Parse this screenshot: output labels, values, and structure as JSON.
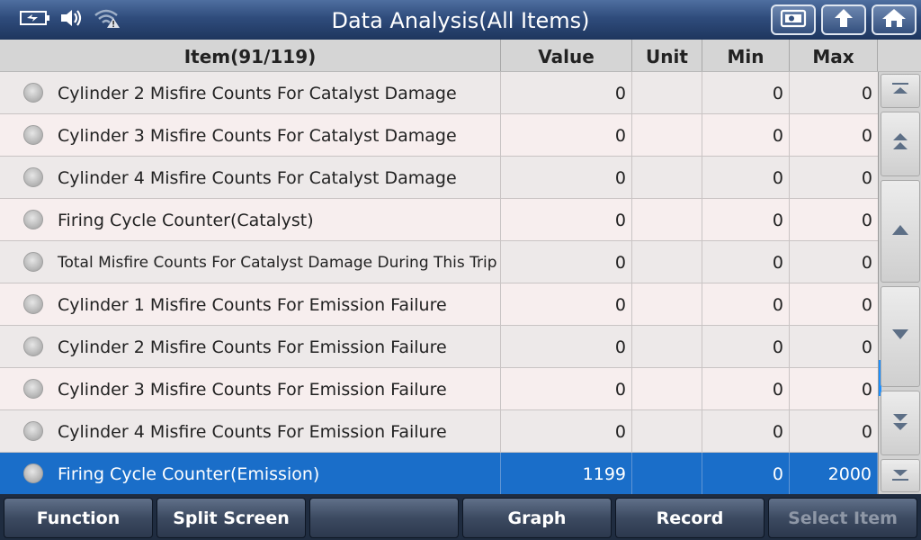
{
  "header": {
    "title": "Data Analysis(All Items)",
    "status_icons": [
      "battery-icon",
      "speaker-icon",
      "wifi-warning-icon"
    ],
    "buttons": [
      "screenshot-icon",
      "back-icon",
      "home-icon"
    ]
  },
  "table": {
    "columns": {
      "item": "Item(91/119)",
      "value": "Value",
      "unit": "Unit",
      "min": "Min",
      "max": "Max"
    },
    "rows": [
      {
        "item": "Cylinder 2 Misfire Counts For Catalyst Damage",
        "value": "0",
        "unit": "",
        "min": "0",
        "max": "0"
      },
      {
        "item": "Cylinder 3 Misfire Counts For Catalyst Damage",
        "value": "0",
        "unit": "",
        "min": "0",
        "max": "0"
      },
      {
        "item": "Cylinder 4 Misfire Counts For Catalyst Damage",
        "value": "0",
        "unit": "",
        "min": "0",
        "max": "0"
      },
      {
        "item": "Firing Cycle Counter(Catalyst)",
        "value": "0",
        "unit": "",
        "min": "0",
        "max": "0"
      },
      {
        "item": "Total Misfire Counts For Catalyst Damage During This Trip",
        "value": "0",
        "unit": "",
        "min": "0",
        "max": "0"
      },
      {
        "item": "Cylinder 1 Misfire Counts For Emission Failure",
        "value": "0",
        "unit": "",
        "min": "0",
        "max": "0"
      },
      {
        "item": "Cylinder 2 Misfire Counts For Emission Failure",
        "value": "0",
        "unit": "",
        "min": "0",
        "max": "0"
      },
      {
        "item": "Cylinder 3 Misfire Counts For Emission Failure",
        "value": "0",
        "unit": "",
        "min": "0",
        "max": "0"
      },
      {
        "item": "Cylinder 4 Misfire Counts For Emission Failure",
        "value": "0",
        "unit": "",
        "min": "0",
        "max": "0"
      },
      {
        "item": "Firing Cycle Counter(Emission)",
        "value": "1199",
        "unit": "",
        "min": "0",
        "max": "2000"
      }
    ],
    "selected_row": 9
  },
  "scroll_buttons": [
    "scroll-top-icon",
    "page-up-icon",
    "line-up-icon",
    "line-down-icon",
    "page-down-icon",
    "scroll-bottom-icon"
  ],
  "toolbar": {
    "function": "Function",
    "split_screen": "Split Screen",
    "empty": "",
    "graph": "Graph",
    "record": "Record",
    "select_item": "Select Item"
  },
  "colors": {
    "selected_row": "#1a6ec9",
    "title_bar": "#2f4c7c",
    "scroll_thumb": "#1e90ff"
  }
}
